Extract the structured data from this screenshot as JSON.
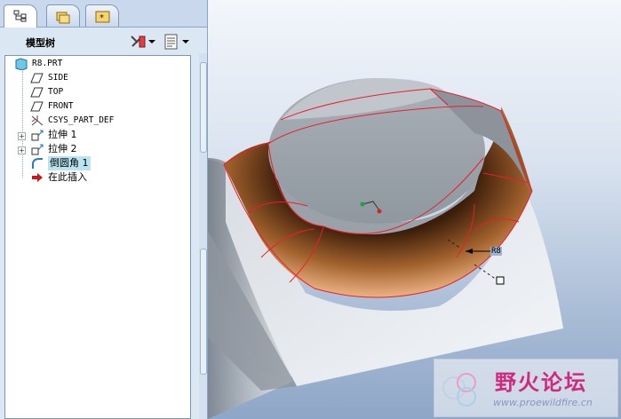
{
  "panel": {
    "title": "模型树"
  },
  "tabs": [
    {
      "name": "model-tree"
    },
    {
      "name": "folder-browser"
    },
    {
      "name": "favorites"
    }
  ],
  "tree": {
    "root": "R8.PRT",
    "items": [
      {
        "label": "SIDE",
        "icon": "datum-plane-icon"
      },
      {
        "label": "TOP",
        "icon": "datum-plane-icon"
      },
      {
        "label": "FRONT",
        "icon": "datum-plane-icon"
      },
      {
        "label": "CSYS_PART_DEF",
        "icon": "csys-icon"
      },
      {
        "label": "拉伸 1",
        "icon": "extrude-icon"
      },
      {
        "label": "拉伸 2",
        "icon": "extrude-icon"
      },
      {
        "label": "倒圆角 1",
        "icon": "round-icon",
        "selected": true
      },
      {
        "label": "在此插入",
        "icon": "insert-here-arrow-icon"
      }
    ]
  },
  "viewport": {
    "dimension": "R8"
  },
  "watermark": {
    "text": "野火论坛",
    "url": "www.proewildfire.cn"
  },
  "colors": {
    "accent_edge": "#e8202a",
    "selection": "#b9e4f0"
  }
}
